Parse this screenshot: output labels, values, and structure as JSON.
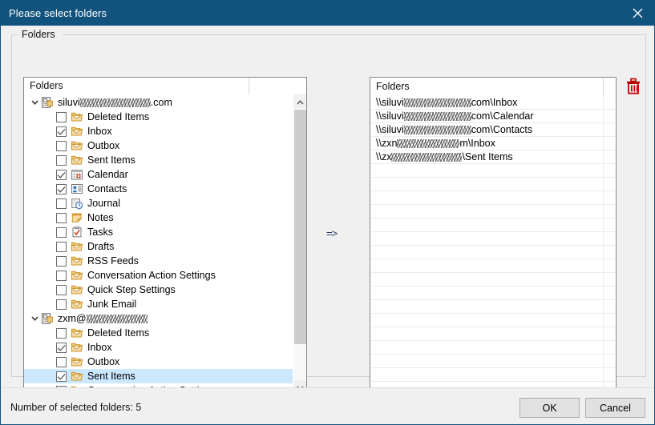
{
  "window": {
    "title": "Please select folders",
    "close_icon": "close-icon"
  },
  "groupbox": {
    "label": "Folders"
  },
  "tree": {
    "column_header": "Folders",
    "scroll": {
      "up_icon": "chevron-up-icon",
      "down_icon": "chevron-down-icon"
    },
    "accounts": [
      {
        "name_prefix": "siluvi",
        "name_suffix": ".com",
        "redacted_width": 88,
        "expanded": true,
        "expander_icon": "chevron-down-icon",
        "account_icon": "account-folder-icon",
        "folders": [
          {
            "label": "Deleted Items",
            "checked": false,
            "icon": "mail-folder-icon",
            "selected": false
          },
          {
            "label": "Inbox",
            "checked": true,
            "icon": "mail-folder-icon",
            "selected": false
          },
          {
            "label": "Outbox",
            "checked": false,
            "icon": "mail-folder-icon",
            "selected": false
          },
          {
            "label": "Sent Items",
            "checked": false,
            "icon": "mail-folder-icon",
            "selected": false
          },
          {
            "label": "Calendar",
            "checked": true,
            "icon": "calendar-icon",
            "selected": false
          },
          {
            "label": "Contacts",
            "checked": true,
            "icon": "contacts-icon",
            "selected": false
          },
          {
            "label": "Journal",
            "checked": false,
            "icon": "journal-icon",
            "selected": false
          },
          {
            "label": "Notes",
            "checked": false,
            "icon": "notes-icon",
            "selected": false
          },
          {
            "label": "Tasks",
            "checked": false,
            "icon": "tasks-icon",
            "selected": false
          },
          {
            "label": "Drafts",
            "checked": false,
            "icon": "mail-folder-icon",
            "selected": false
          },
          {
            "label": "RSS Feeds",
            "checked": false,
            "icon": "mail-folder-icon",
            "selected": false
          },
          {
            "label": "Conversation Action Settings",
            "checked": false,
            "icon": "mail-folder-icon",
            "selected": false
          },
          {
            "label": "Quick Step Settings",
            "checked": false,
            "icon": "mail-folder-icon",
            "selected": false
          },
          {
            "label": "Junk Email",
            "checked": false,
            "icon": "mail-folder-icon",
            "selected": false
          }
        ]
      },
      {
        "name_prefix": "zxm@",
        "name_suffix": "",
        "redacted_width": 76,
        "expanded": true,
        "expander_icon": "chevron-down-icon",
        "account_icon": "account-folder-icon",
        "folders": [
          {
            "label": "Deleted Items",
            "checked": false,
            "icon": "mail-folder-icon",
            "selected": false
          },
          {
            "label": "Inbox",
            "checked": true,
            "icon": "mail-folder-icon",
            "selected": false
          },
          {
            "label": "Outbox",
            "checked": false,
            "icon": "mail-folder-icon",
            "selected": false
          },
          {
            "label": "Sent Items",
            "checked": true,
            "icon": "mail-folder-icon",
            "selected": true
          },
          {
            "label": "Conversation Action Settings",
            "checked": false,
            "icon": "mail-folder-icon",
            "selected": false
          }
        ]
      }
    ]
  },
  "transfer": {
    "arrow_label": "=>"
  },
  "list": {
    "column_header": "Folders",
    "delete_icon": "trash-icon",
    "rows": [
      {
        "prefix": "\\\\siluvi",
        "redacted_width": 84,
        "suffix": "com\\Inbox"
      },
      {
        "prefix": "\\\\siluvi",
        "redacted_width": 84,
        "suffix": "com\\Calendar"
      },
      {
        "prefix": "\\\\siluvi",
        "redacted_width": 84,
        "suffix": "com\\Contacts"
      },
      {
        "prefix": "\\\\zxn",
        "redacted_width": 78,
        "suffix": "m\\Inbox"
      },
      {
        "prefix": "\\\\zx",
        "redacted_width": 88,
        "suffix": "\\Sent Items"
      }
    ],
    "empty_row_count": 17
  },
  "footer": {
    "status": "Number of selected folders:  5",
    "ok_label": "OK",
    "cancel_label": "Cancel"
  },
  "colors": {
    "title_bar": "#12537e",
    "selection": "#cce8ff",
    "accent_red": "#c00000",
    "dialog_bg": "#f0f0f0"
  }
}
